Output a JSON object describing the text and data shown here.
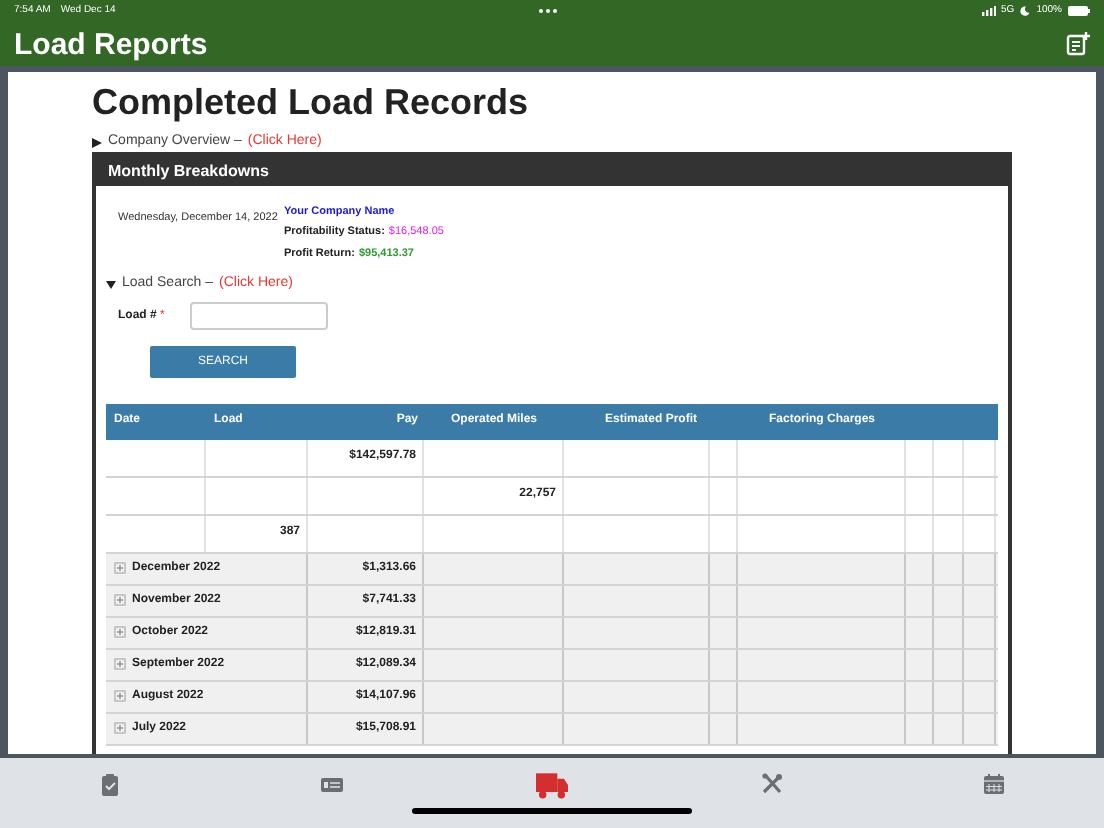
{
  "status_bar": {
    "time": "7:54 AM",
    "date": "Wed Dec 14",
    "network": "5G",
    "battery": "100%"
  },
  "app_bar": {
    "title": "Load Reports"
  },
  "page": {
    "heading": "Completed Load Records",
    "company_overview": {
      "label": "Company Overview –",
      "link": "(Click Here)",
      "expanded": false
    }
  },
  "panel": {
    "title": "Monthly Breakdowns",
    "date": "Wednesday, December 14, 2022",
    "company_name": "Your Company Name",
    "profitability_label": "Profitability Status:",
    "profitability_value": "$16,548.05",
    "profit_return_label": "Profit Return:",
    "profit_return_value": "$95,413.37",
    "load_search": {
      "label": "Load Search –",
      "link": "(Click Here)",
      "expanded": true
    },
    "load_field": {
      "label": "Load #",
      "required_mark": "*"
    },
    "search_button": "SEARCH"
  },
  "table": {
    "columns": [
      "Date",
      "Load",
      "Pay",
      "Operated Miles",
      "Estimated Profit",
      "Factoring Charges"
    ],
    "summary_rows": [
      {
        "kind": "pay",
        "value": "$142,597.78"
      },
      {
        "kind": "miles",
        "value": "22,757"
      },
      {
        "kind": "loads",
        "value": "387"
      }
    ],
    "months": [
      {
        "label": "December 2022",
        "pay": "$1,313.66",
        "expanded": false
      },
      {
        "label": "November 2022",
        "pay": "$7,741.33",
        "expanded": false
      },
      {
        "label": "October 2022",
        "pay": "$12,819.31",
        "expanded": false
      },
      {
        "label": "September 2022",
        "pay": "$12,089.34",
        "expanded": false
      },
      {
        "label": "August 2022",
        "pay": "$14,107.96",
        "expanded": false
      },
      {
        "label": "July 2022",
        "pay": "$15,708.91",
        "expanded": false
      }
    ]
  },
  "tab_bar": [
    {
      "kind": "clipboard",
      "selected": false
    },
    {
      "kind": "card",
      "selected": false
    },
    {
      "kind": "truck",
      "selected": true
    },
    {
      "kind": "tools",
      "selected": false
    },
    {
      "kind": "calendar",
      "selected": false
    }
  ]
}
